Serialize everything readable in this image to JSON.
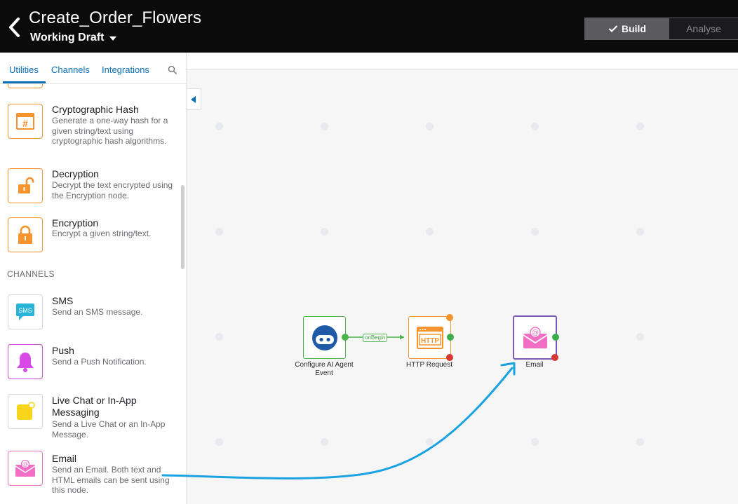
{
  "header": {
    "title": "Create_Order_Flowers",
    "draft_label": "Working Draft",
    "build_label": "Build",
    "analyse_label": "Analyse"
  },
  "sidebar": {
    "tabs": [
      {
        "label": "Utilities"
      },
      {
        "label": "Channels"
      },
      {
        "label": "Integrations"
      }
    ],
    "items": [
      {
        "title": "Cryptographic Hash",
        "desc": "Generate a one-way hash for a given string/text using cryptographic hash algorithms.",
        "icon": "hash-icon"
      },
      {
        "title": "Decryption",
        "desc": "Decrypt the text encrypted using the Encryption node.",
        "icon": "unlock-icon"
      },
      {
        "title": "Encryption",
        "desc": "Encrypt a given string/text.",
        "icon": "lock-icon"
      }
    ],
    "channels_label": "CHANNELS",
    "channels": [
      {
        "title": "SMS",
        "desc": "Send an SMS message.",
        "icon_text": "SMS"
      },
      {
        "title": "Push",
        "desc": "Send a Push Notification."
      },
      {
        "title": "Live Chat or In-App Messaging",
        "desc": "Send a Live Chat or an In-App Message."
      },
      {
        "title": "Email",
        "desc": "Send an Email. Both text and HTML emails can be sent using this node."
      }
    ]
  },
  "canvas": {
    "nodes": [
      {
        "label": "Configure AI Agent Event"
      },
      {
        "label": "HTTP Request",
        "icon_text": "HTTP"
      },
      {
        "label": "Email"
      }
    ],
    "edge_label": "onBegin"
  },
  "colors": {
    "accent": "#0b6fb8",
    "orange": "#f5942c",
    "green": "#3aae4a",
    "purple": "#7a5cb8",
    "pink": "#f06fc4",
    "arrow": "#1aa3e0"
  }
}
